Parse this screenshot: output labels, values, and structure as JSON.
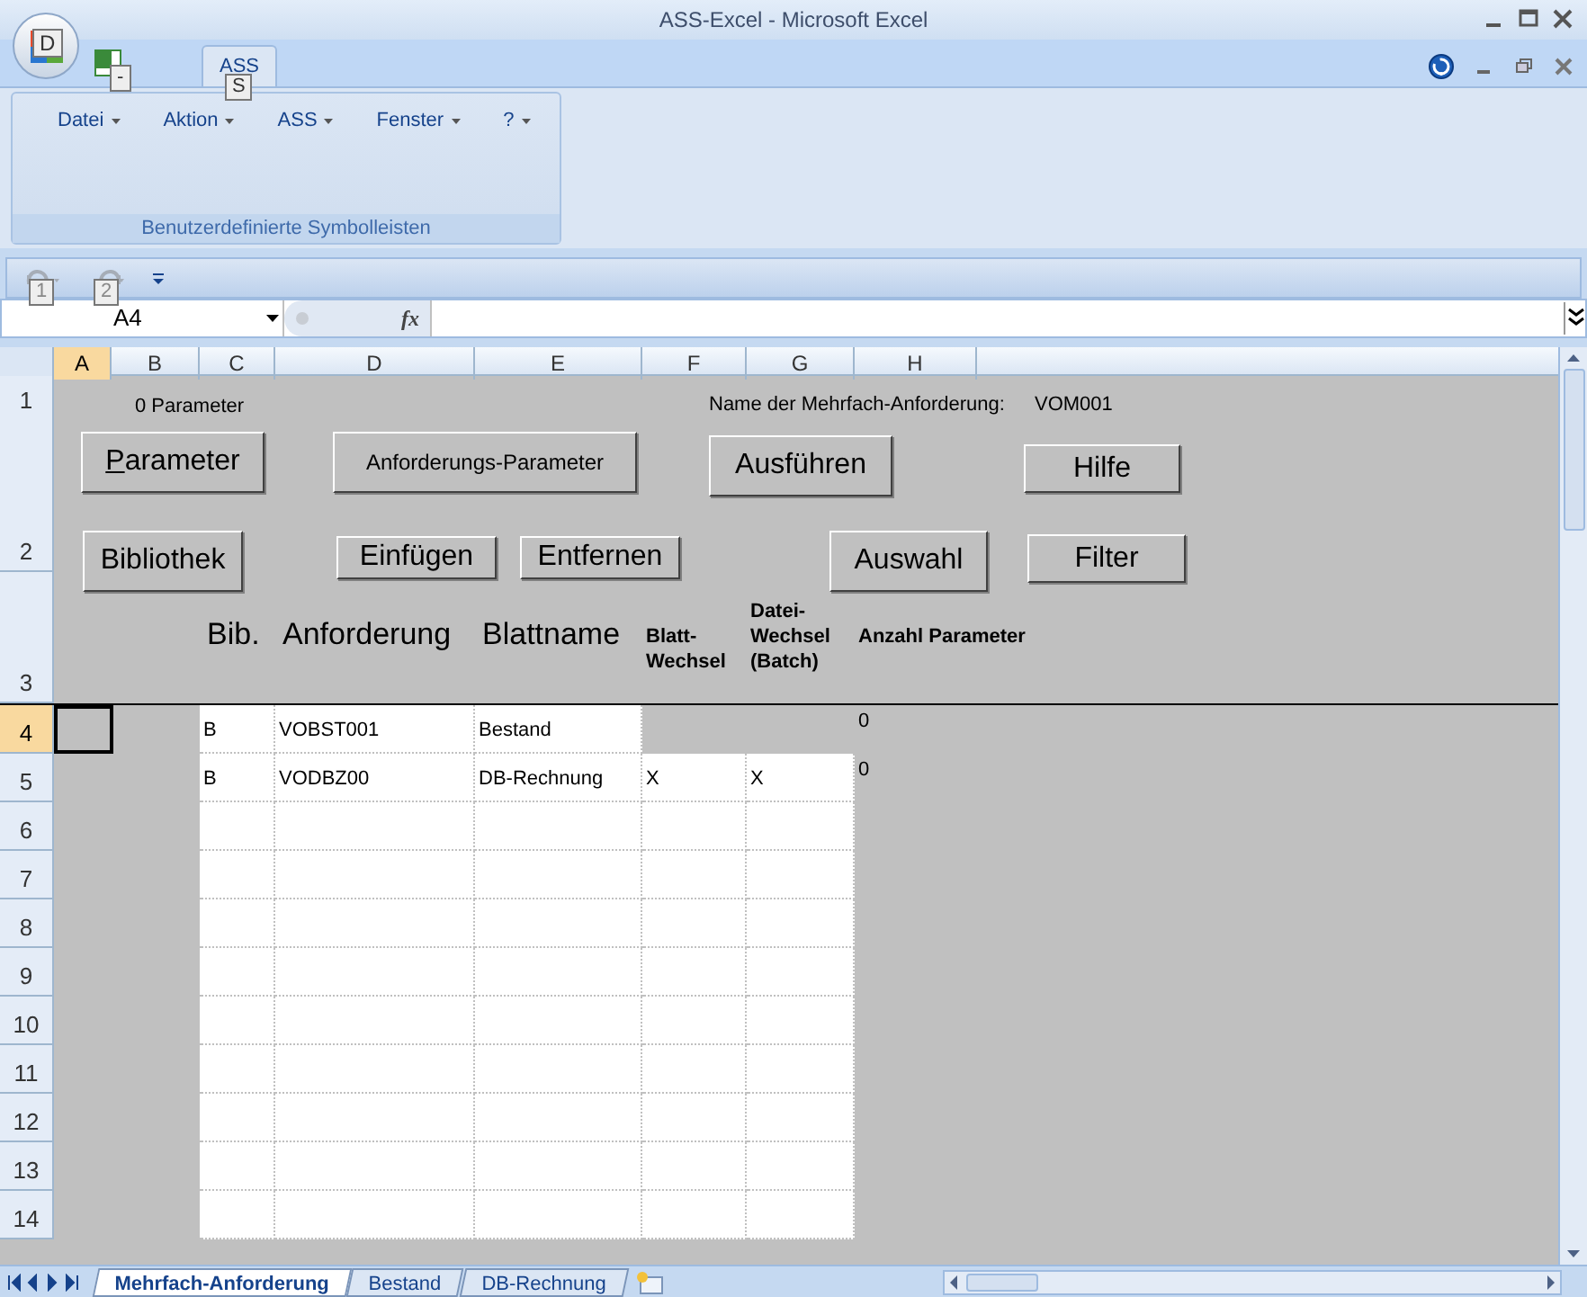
{
  "window": {
    "title": "ASS-Excel - Microsoft Excel"
  },
  "office_button": {
    "keytip": "D"
  },
  "quick_icon": {
    "keytip": "-"
  },
  "ribbon_tabs": [
    {
      "label": "ASS",
      "selected": true,
      "keytip": "S"
    }
  ],
  "ribbon": {
    "menus": [
      {
        "label": "Datei"
      },
      {
        "label": "Aktion"
      },
      {
        "label": "ASS"
      },
      {
        "label": "Fenster"
      },
      {
        "label": "?"
      }
    ],
    "group_label": "Benutzerdefinierte Symbolleisten"
  },
  "quick_access": {
    "keytips": [
      "1",
      "2"
    ]
  },
  "formula_bar": {
    "name_box": "A4",
    "function_label": "fx"
  },
  "columns": [
    {
      "label": "A",
      "selected": true
    },
    {
      "label": "B",
      "selected": false
    },
    {
      "label": "C",
      "selected": false
    },
    {
      "label": "D",
      "selected": false
    },
    {
      "label": "E",
      "selected": false
    },
    {
      "label": "F",
      "selected": false
    },
    {
      "label": "G",
      "selected": false
    },
    {
      "label": "H",
      "selected": false
    }
  ],
  "info": {
    "parameter_count": "0 Parameter",
    "name_label": "Name der Mehrfach-Anforderung:",
    "name_value": "VOM001"
  },
  "buttons": [
    {
      "access_key": "P",
      "rest": "arameter"
    },
    {
      "label": "Anforderungs-Parameter"
    },
    {
      "label": "Ausführen"
    },
    {
      "label": "Hilfe"
    },
    {
      "label": "Bibliothek"
    },
    {
      "label": "Einfügen"
    },
    {
      "label": "Entfernen"
    },
    {
      "label": "Auswahl"
    },
    {
      "label": "Filter"
    }
  ],
  "table_headers": [
    {
      "label": "Bib.",
      "kind": "large"
    },
    {
      "label": "Anforderung",
      "kind": "large"
    },
    {
      "label": "Blattname",
      "kind": "large"
    },
    {
      "label": "Blatt-Wechsel",
      "kind": "small"
    },
    {
      "label": "Datei-Wechsel (Batch)",
      "kind": "small"
    },
    {
      "label": "Anzahl Parameter",
      "kind": "small"
    }
  ],
  "rows": [
    {
      "label": "1",
      "selected": false
    },
    {
      "label": "2",
      "selected": false
    },
    {
      "label": "3",
      "selected": false
    },
    {
      "label": "4",
      "selected": true,
      "cells": [
        "B",
        "VOBST001",
        "Bestand",
        "",
        "",
        "0"
      ]
    },
    {
      "label": "5",
      "selected": false,
      "cells": [
        "B",
        "VODBZ00",
        "DB-Rechnung",
        "X",
        "X",
        "0"
      ]
    },
    {
      "label": "6",
      "selected": false
    },
    {
      "label": "7",
      "selected": false
    },
    {
      "label": "8",
      "selected": false
    },
    {
      "label": "9",
      "selected": false
    },
    {
      "label": "10",
      "selected": false
    },
    {
      "label": "11",
      "selected": false
    },
    {
      "label": "12",
      "selected": false
    },
    {
      "label": "13",
      "selected": false
    },
    {
      "label": "14",
      "selected": false
    }
  ],
  "sheet_tabs": [
    {
      "label": "Mehrfach-Anforderung",
      "selected": true
    },
    {
      "label": "Bestand",
      "selected": false
    },
    {
      "label": "DB-Rechnung",
      "selected": false
    }
  ]
}
